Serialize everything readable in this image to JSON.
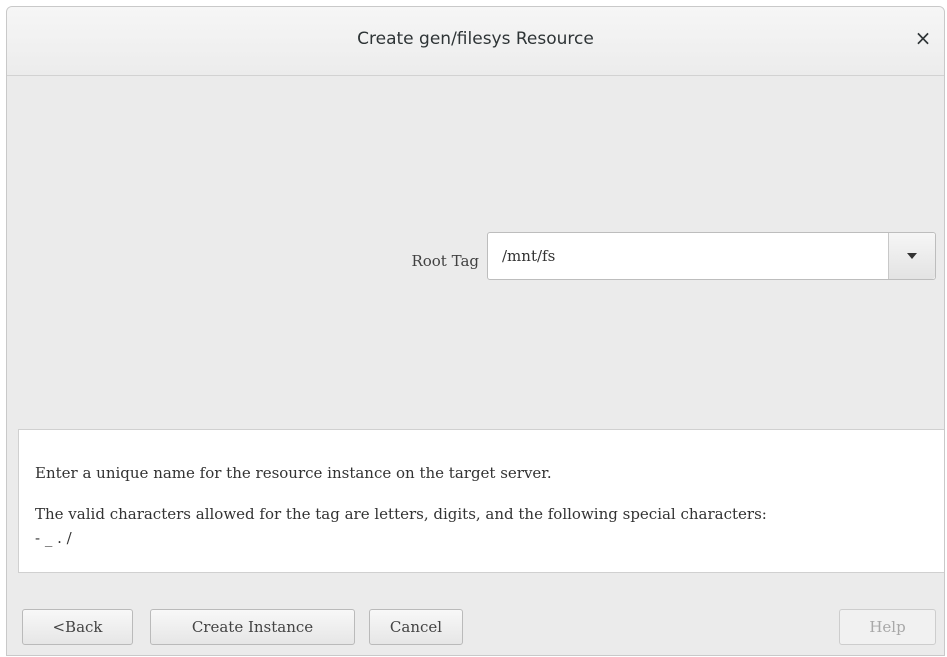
{
  "dialog": {
    "title": "Create gen/filesys Resource",
    "close_glyph": "×"
  },
  "form": {
    "root_tag_label": "Root Tag",
    "root_tag_value": "/mnt/fs"
  },
  "info": {
    "line1": "Enter a unique name for the resource instance on the target server.",
    "line2": "The valid characters allowed for the tag are letters, digits, and the following special characters:",
    "line3": "- _ . /"
  },
  "buttons": {
    "back": "<Back",
    "create": "Create Instance",
    "cancel": "Cancel",
    "help": "Help"
  },
  "icons": {
    "close": "close-icon",
    "dropdown": "chevron-down-icon"
  }
}
